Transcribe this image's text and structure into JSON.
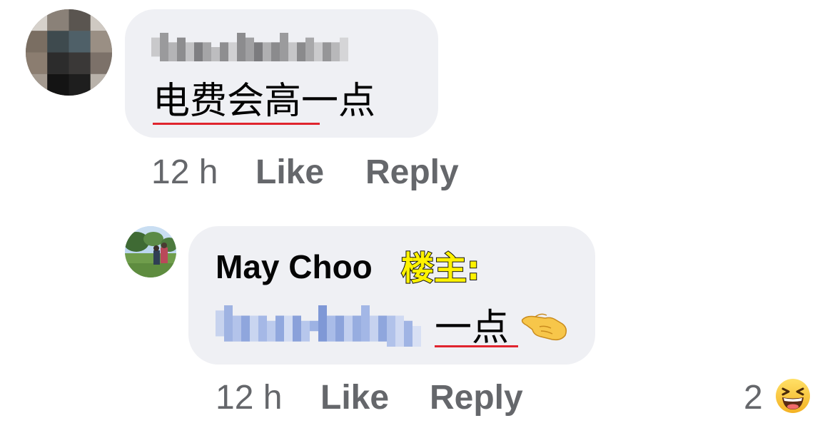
{
  "comment": {
    "text": "电费会高一点",
    "time": "12 h",
    "like_label": "Like",
    "reply_label": "Reply",
    "author_blurred": true,
    "avatar_icon": "pixelated-avatar-icon"
  },
  "reply": {
    "author": "May Choo",
    "op_tag": "楼主:",
    "mention_blurred": true,
    "text": "一点",
    "emoji": "pinching-hand-emoji",
    "time": "12 h",
    "like_label": "Like",
    "reply_label": "Reply",
    "reaction_count": "2",
    "reaction_emoji": "laughing-face-emoji",
    "avatar_icon": "outdoor-photo-avatar-icon"
  },
  "colors": {
    "bubble": "#eff0f4",
    "meta_text": "#65676b",
    "underline": "#e0242e",
    "op_tag": "#fff200"
  }
}
